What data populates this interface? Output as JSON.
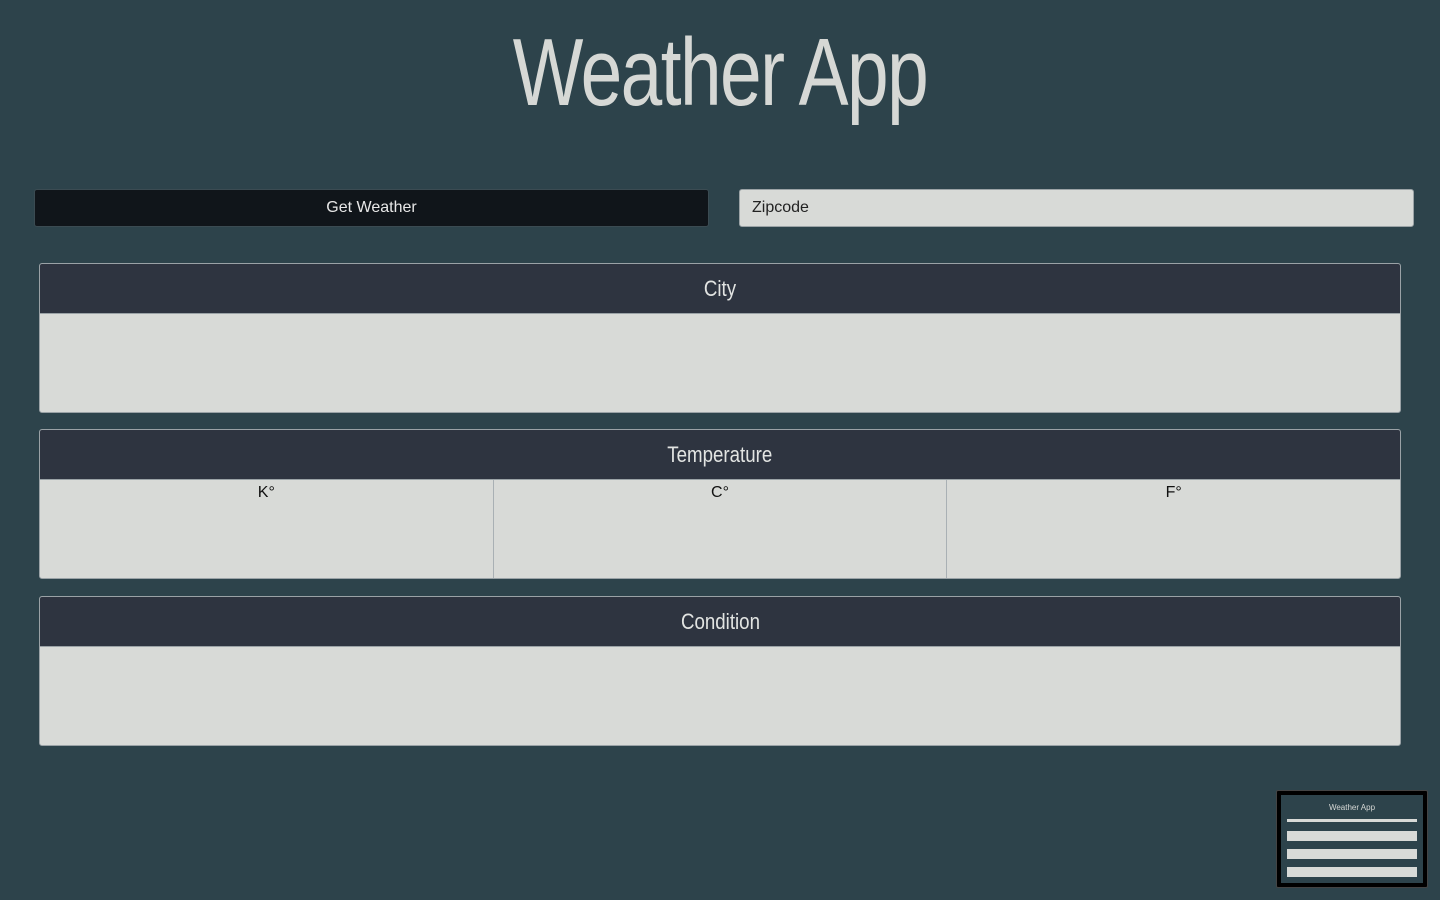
{
  "app": {
    "title": "Weather App"
  },
  "controls": {
    "get_weather_label": "Get Weather",
    "zipcode_placeholder": "Zipcode",
    "zipcode_value": ""
  },
  "cards": {
    "city": {
      "header": "City",
      "value": ""
    },
    "temperature": {
      "header": "Temperature",
      "columns": [
        "K°",
        "C°",
        "F°"
      ]
    },
    "condition": {
      "header": "Condition",
      "value": ""
    }
  },
  "minimap": {
    "title": "Weather App"
  },
  "colors": {
    "background": "#2d434b",
    "card_header": "#2e3440",
    "card_body": "#d8dad7",
    "button": "#10151a"
  }
}
